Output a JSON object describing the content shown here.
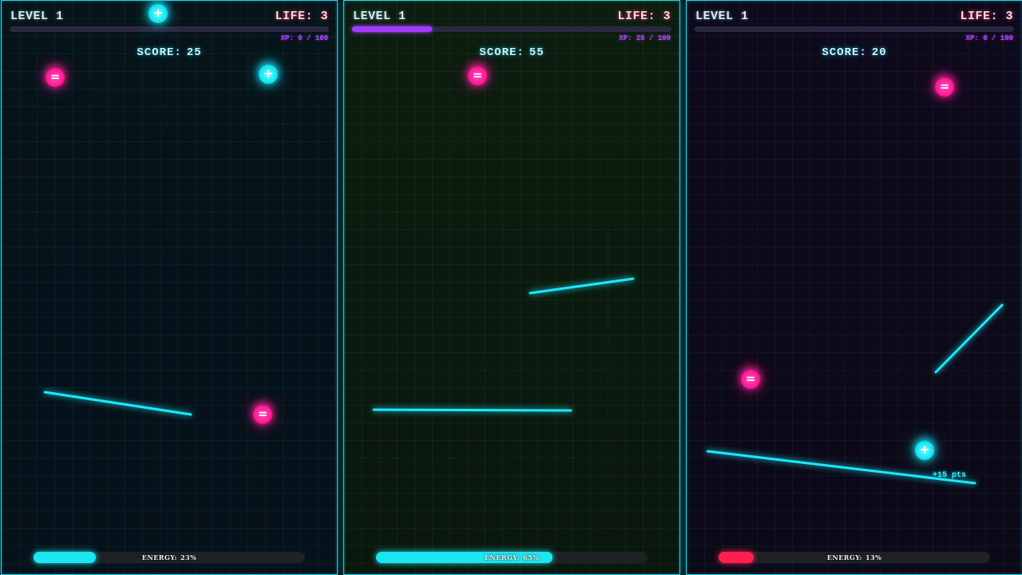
{
  "colors": {
    "accent_cyan": "#19eaff",
    "minus_orb": "#ff1f9a",
    "xp_purple": "#a13cff",
    "energy_low_red": "#ff1f4f"
  },
  "panels": [
    {
      "level_label": "LEVEL",
      "level_value": "1",
      "life_label": "LIFE:",
      "life_value": "3",
      "xp_label": "XP:",
      "xp_text": "0 / 100",
      "xp_progress": 0,
      "score_label": "SCORE:",
      "score_value": "25",
      "energy_label": "ENERGY:",
      "energy_text": "23%",
      "energy_level": 0.23,
      "energy_color": "#1ce6f0",
      "orbs": [
        {
          "type": "plus",
          "icon": "plus-icon"
        },
        {
          "type": "minus",
          "icon": "minus-icon"
        },
        {
          "type": "plus",
          "icon": "plus-icon"
        },
        {
          "type": "minus",
          "icon": "minus-icon"
        }
      ],
      "floating_text": ""
    },
    {
      "level_label": "LEVEL",
      "level_value": "1",
      "life_label": "LIFE:",
      "life_value": "3",
      "xp_label": "XP:",
      "xp_text": "25 / 100",
      "xp_progress": 0.25,
      "score_label": "SCORE:",
      "score_value": "55",
      "energy_label": "ENERGY:",
      "energy_text": "65%",
      "energy_level": 0.65,
      "energy_color": "#1ce6f0",
      "orbs": [
        {
          "type": "minus",
          "icon": "minus-icon"
        }
      ],
      "floating_text": ""
    },
    {
      "level_label": "LEVEL",
      "level_value": "1",
      "life_label": "LIFE:",
      "life_value": "3",
      "xp_label": "XP:",
      "xp_text": "0 / 100",
      "xp_progress": 0,
      "score_label": "SCORE:",
      "score_value": "20",
      "energy_label": "ENERGY:",
      "energy_text": "13%",
      "energy_level": 0.13,
      "energy_color": "#ff1f4f",
      "orbs": [
        {
          "type": "minus",
          "icon": "minus-icon"
        },
        {
          "type": "minus",
          "icon": "minus-icon"
        },
        {
          "type": "plus",
          "icon": "plus-icon"
        }
      ],
      "floating_text": "+15 pts"
    }
  ]
}
